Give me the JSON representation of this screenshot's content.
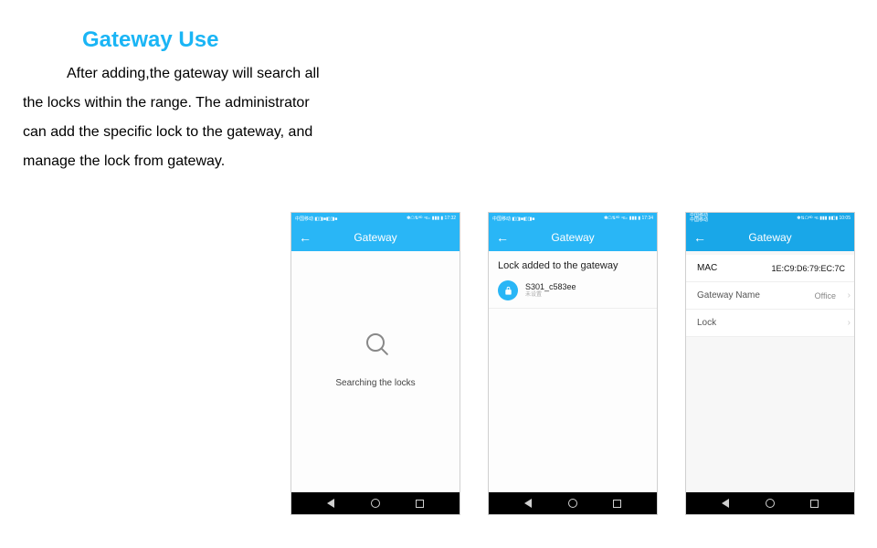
{
  "heading": "Gateway Use",
  "description": "After adding,the gateway will search all the locks within the range. The administrator can add the specific lock to the gateway, and manage the lock from gateway.",
  "phones": {
    "p1": {
      "status_left": "中国移动 ◧◨■◧◨■",
      "status_right": "✽☖⇅ᴴᴰ ⁴ɢ₊ ▮▮▮ ▮ 17:32",
      "title": "Gateway",
      "searching": "Searching the locks"
    },
    "p2": {
      "status_left": "中国移动 ◧◨■◧◨■",
      "status_right": "✽☖⇅ᴴᴰ ⁴ɢ₊ ▮▮▮ ▮ 17:34",
      "title": "Gateway",
      "subheader": "Lock added to the gateway",
      "lock_name": "S301_c583ee",
      "lock_sub": "未设置"
    },
    "p3": {
      "status_left": "中国移动\n中国移动",
      "status_right": "✽⇅☖ᴴᴰ ⁴ɢ ▮▮▮ ▮◧▮ 10:05",
      "title": "Gateway",
      "rows": {
        "mac_label": "MAC",
        "mac_value": "1E:C9:D6:79:EC:7C",
        "name_label": "Gateway Name",
        "name_value": "Office",
        "lock_label": "Lock",
        "lock_value": ""
      }
    }
  }
}
